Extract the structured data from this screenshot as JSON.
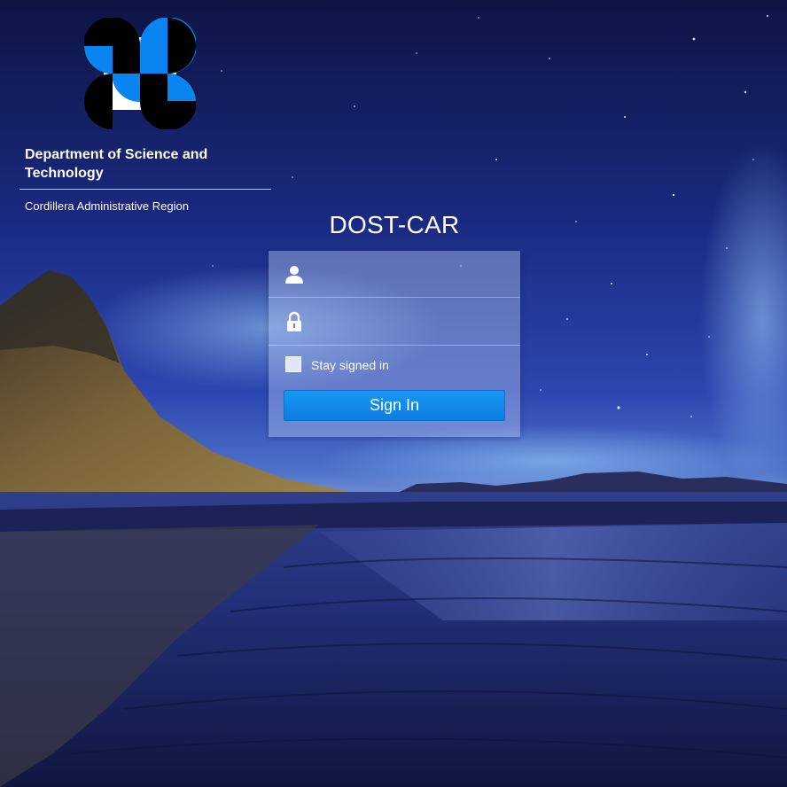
{
  "brand": {
    "agency_name": "Department of Science and Technology",
    "region": "Cordillera Administrative Region",
    "logo_icon": "dost-logo-icon",
    "colors": {
      "blue": "#0a84f0",
      "black": "#000000",
      "white": "#ffffff"
    }
  },
  "login": {
    "title": "DOST-CAR",
    "username": {
      "icon": "user-icon",
      "value": "",
      "placeholder": ""
    },
    "password": {
      "icon": "lock-icon",
      "value": "",
      "placeholder": ""
    },
    "stay_signed_in": {
      "label": "Stay signed in",
      "checked": false
    },
    "submit_label": "Sign In",
    "accent": "#0b85e8"
  },
  "background": {
    "scene": "night sky with mountain over tidal beach"
  }
}
